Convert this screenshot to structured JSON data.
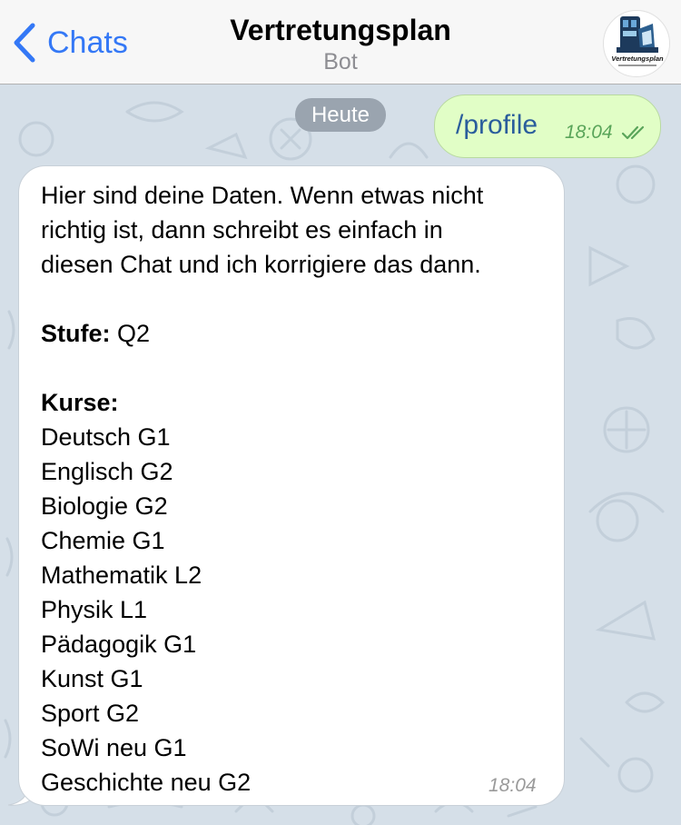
{
  "header": {
    "back_label": "Chats",
    "title": "Vertretungsplan",
    "subtitle": "Bot",
    "avatar_caption": "Vertretungsplan"
  },
  "chat": {
    "date_label": "Heute",
    "outgoing": {
      "text": "/profile",
      "time": "18:04",
      "status_icon": "double-check-icon"
    },
    "incoming": {
      "intro_lines": [
        "Hier sind deine Daten. Wenn etwas nicht",
        "richtig ist, dann schreibt es einfach in",
        "diesen Chat und ich korrigiere das dann."
      ],
      "stufe_label": "Stufe:",
      "stufe_value": "Q2",
      "kurse_label": "Kurse:",
      "kurse": [
        "Deutsch G1",
        "Englisch G2",
        "Biologie G2",
        "Chemie G1",
        "Mathematik L2",
        "Physik L1",
        "Pädagogik G1",
        "Kunst G1",
        "Sport G2",
        "SoWi neu G1",
        "Geschichte neu G2"
      ],
      "time": "18:04"
    }
  },
  "colors": {
    "accent": "#3478f6",
    "outgoing_bubble": "#e1fec6",
    "incoming_bubble": "#ffffff",
    "chat_background": "#d5dfe8"
  }
}
